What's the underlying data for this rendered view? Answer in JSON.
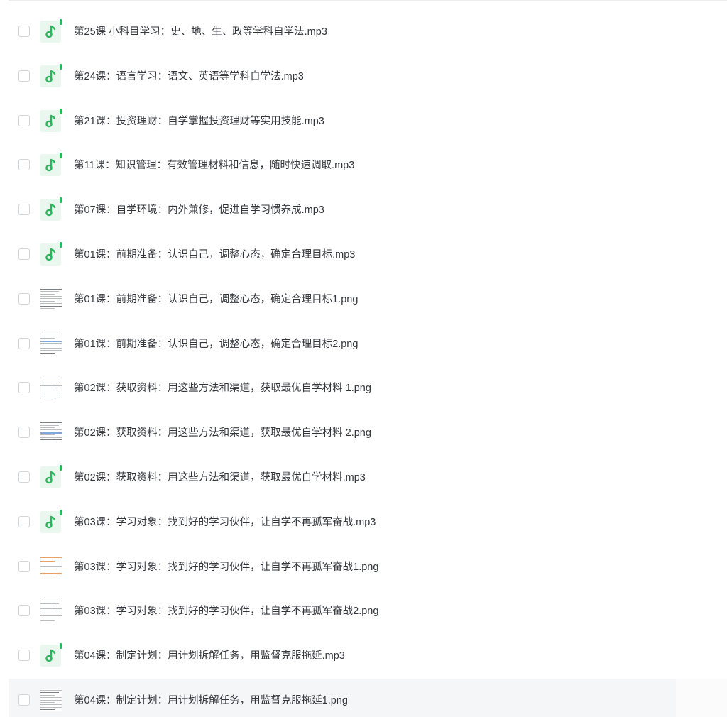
{
  "colors": {
    "text": "#33373d",
    "audio_icon_bg": "#eaf7ef",
    "audio_icon_fg": "#2bb55d",
    "highlight_row": "#f5f6f7"
  },
  "files": [
    {
      "name": "第25课 小科目学习：史、地、生、政等学科自学法.mp3",
      "type": "audio",
      "icon": "music-note-icon"
    },
    {
      "name": "第24课：语言学习：语文、英语等学科自学法.mp3",
      "type": "audio",
      "icon": "music-note-icon"
    },
    {
      "name": "第21课：投资理财：自学掌握投资理财等实用技能.mp3",
      "type": "audio",
      "icon": "music-note-icon"
    },
    {
      "name": "第11课：知识管理：有效管理材料和信息，随时快速调取.mp3",
      "type": "audio",
      "icon": "music-note-icon"
    },
    {
      "name": "第07课：自学环境：内外兼修，促进自学习惯养成.mp3",
      "type": "audio",
      "icon": "music-note-icon"
    },
    {
      "name": "第01课：前期准备：认识自己，调整心态，确定合理目标.mp3",
      "type": "audio",
      "icon": "music-note-icon"
    },
    {
      "name": "第01课：前期准备：认识自己，调整心态，确定合理目标1.png",
      "type": "image",
      "icon": "image-thumbnail"
    },
    {
      "name": "第01课：前期准备：认识自己，调整心态，确定合理目标2.png",
      "type": "image",
      "icon": "image-thumbnail"
    },
    {
      "name": "第02课：获取资料：用这些方法和渠道，获取最优自学材料 1.png",
      "type": "image",
      "icon": "image-thumbnail"
    },
    {
      "name": "第02课：获取资料：用这些方法和渠道，获取最优自学材料 2.png",
      "type": "image",
      "icon": "image-thumbnail"
    },
    {
      "name": "第02课：获取资料：用这些方法和渠道，获取最优自学材料.mp3",
      "type": "audio",
      "icon": "music-note-icon"
    },
    {
      "name": "第03课：学习对象：找到好的学习伙伴，让自学不再孤军奋战.mp3",
      "type": "audio",
      "icon": "music-note-icon"
    },
    {
      "name": "第03课：学习对象：找到好的学习伙伴，让自学不再孤军奋战1.png",
      "type": "image",
      "icon": "image-thumbnail"
    },
    {
      "name": "第03课：学习对象：找到好的学习伙伴，让自学不再孤军奋战2.png",
      "type": "image",
      "icon": "image-thumbnail"
    },
    {
      "name": "第04课：制定计划：用计划拆解任务，用监督克服拖延.mp3",
      "type": "audio",
      "icon": "music-note-icon"
    },
    {
      "name": "第04课：制定计划：用计划拆解任务，用监督克服拖延1.png",
      "type": "image",
      "icon": "image-thumbnail",
      "hovered": true
    }
  ]
}
